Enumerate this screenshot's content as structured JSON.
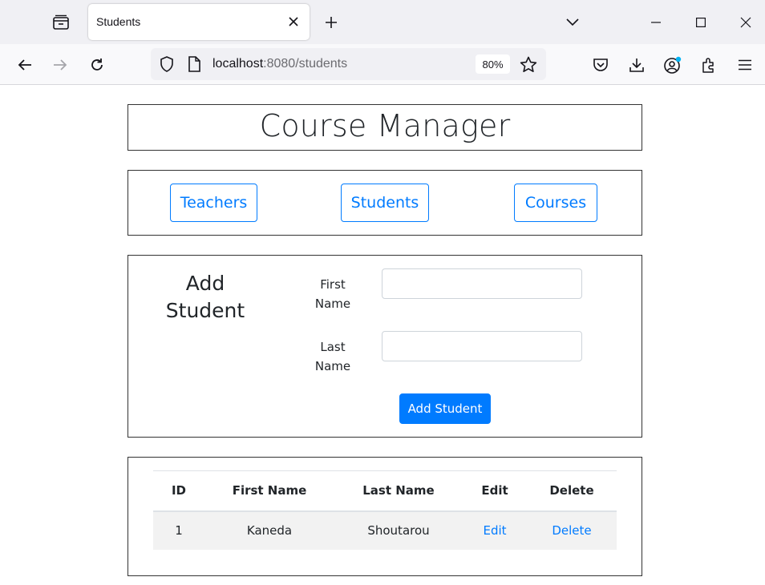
{
  "browser": {
    "tab_title": "Students",
    "url_host": "localhost",
    "url_rest": ":8080/students",
    "zoom": "80%"
  },
  "page": {
    "title": "Course Manager",
    "nav": {
      "teachers": "Teachers",
      "students": "Students",
      "courses": "Courses"
    },
    "form": {
      "heading": "Add Student",
      "first_name_label": "First Name",
      "last_name_label": "Last Name",
      "first_name_value": "",
      "last_name_value": "",
      "submit_label": "Add Student"
    },
    "table": {
      "headers": {
        "id": "ID",
        "first_name": "First Name",
        "last_name": "Last Name",
        "edit": "Edit",
        "delete": "Delete"
      },
      "rows": [
        {
          "id": "1",
          "first_name": "Kaneda",
          "last_name": "Shoutarou",
          "edit": "Edit",
          "delete": "Delete"
        }
      ]
    }
  },
  "colors": {
    "accent": "#007bff",
    "border": "#333333",
    "row_stripe": "#f2f2f2"
  },
  "icons": {
    "tab_list": "tab-list-icon",
    "close": "close-icon",
    "new_tab": "plus-icon",
    "tabs_menu": "chevron-down-icon",
    "back": "back-arrow-icon",
    "forward": "forward-arrow-icon",
    "reload": "reload-icon",
    "shield": "shield-icon",
    "page": "page-icon",
    "star": "star-icon",
    "pocket": "pocket-icon",
    "download": "download-icon",
    "account": "account-icon",
    "extensions": "extensions-icon",
    "menu": "hamburger-menu-icon"
  }
}
